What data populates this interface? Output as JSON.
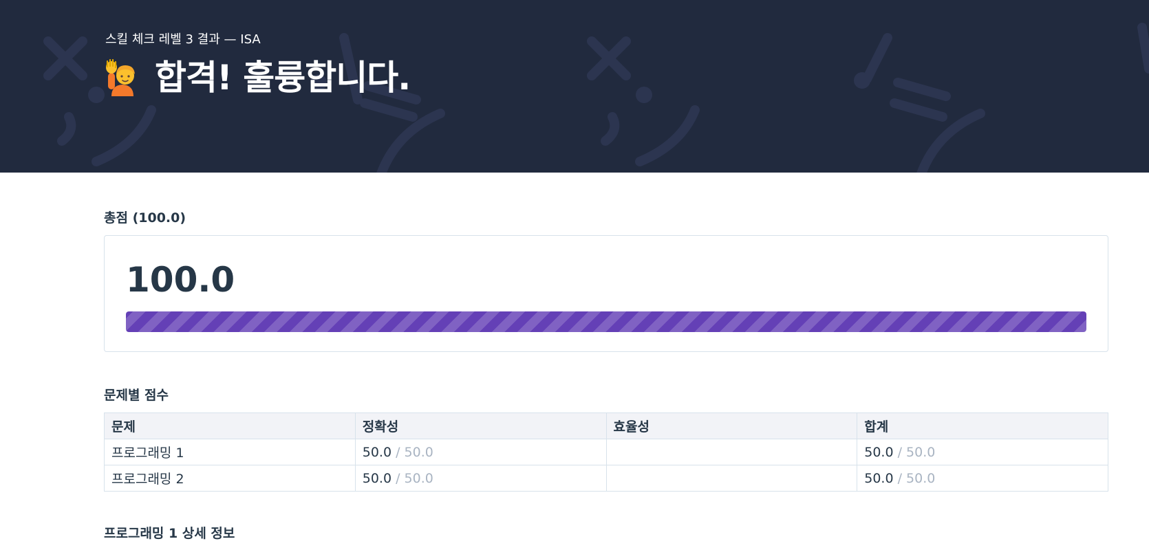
{
  "header": {
    "subtitle": "스킬 체크 레벨 3 결과 — ISA",
    "emoji_icon": "person-raising-hand-icon",
    "title": "합격! 훌륭합니다."
  },
  "colors": {
    "header_bg": "#212a3e",
    "progress_fill": "#6440b6",
    "text": "#263747",
    "muted": "#a9b4c2",
    "border": "#d7e2eb",
    "table_header_bg": "#f2f3f7"
  },
  "total": {
    "label": "총점 (100.0)",
    "value": "100.0",
    "progress_percent": 100
  },
  "score_table": {
    "title": "문제별 점수",
    "columns": [
      "문제",
      "정확성",
      "효율성",
      "합계"
    ],
    "rows": [
      {
        "problem": "프로그래밍 1",
        "accuracy": "50.0",
        "accuracy_max": " / 50.0",
        "efficiency": "",
        "total": "50.0",
        "total_max": " / 50.0"
      },
      {
        "problem": "프로그래밍 2",
        "accuracy": "50.0",
        "accuracy_max": " / 50.0",
        "efficiency": "",
        "total": "50.0",
        "total_max": " / 50.0"
      }
    ]
  },
  "detail": {
    "title": "프로그래밍 1 상세 정보"
  }
}
